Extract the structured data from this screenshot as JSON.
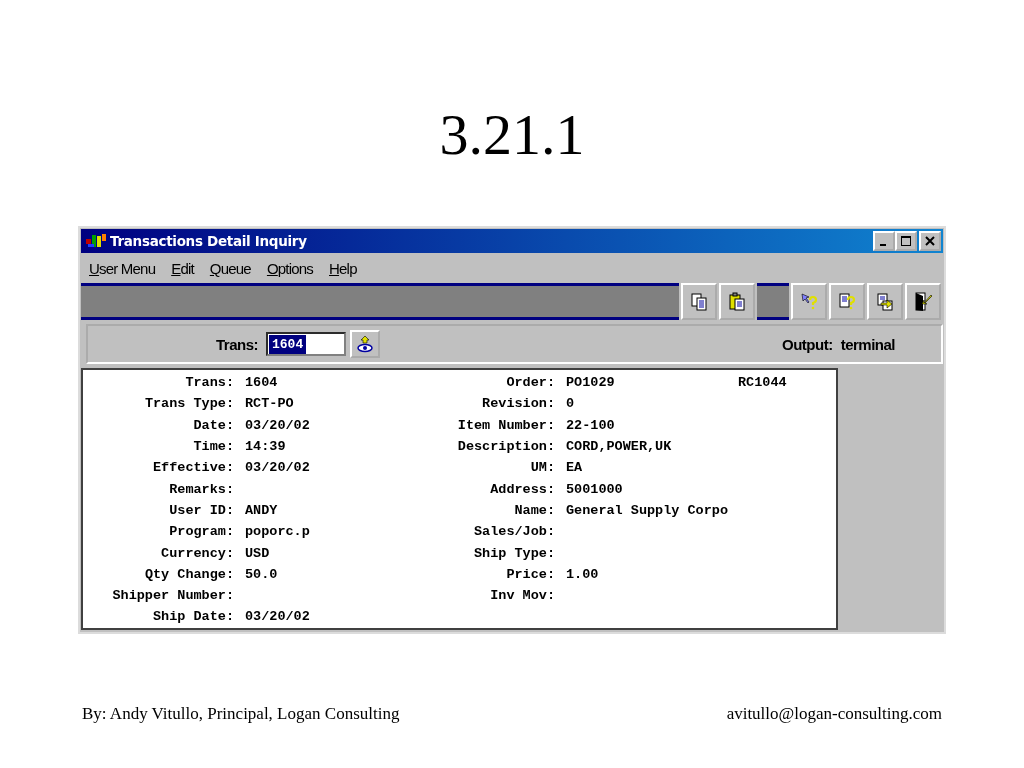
{
  "slide": {
    "title": "3.21.1",
    "footer_left": "By: Andy Vitullo, Principal, Logan Consulting",
    "footer_right": "avitullo@logan-consulting.com"
  },
  "window": {
    "title": "Transactions Detail Inquiry"
  },
  "menu": [
    "User Menu",
    "Edit",
    "Queue",
    "Options",
    "Help"
  ],
  "toolbar": {
    "groups": [
      [
        {
          "kind": "copy"
        },
        {
          "kind": "paste"
        }
      ],
      [
        {
          "kind": "pointer-help"
        },
        {
          "kind": "doc-help"
        },
        {
          "kind": "doc-export"
        },
        {
          "kind": "exit"
        }
      ]
    ]
  },
  "lookup": {
    "label": "Trans:",
    "value": "1604",
    "value_selected": true,
    "output_label": "Output:",
    "output_value": "terminal"
  },
  "detail": {
    "left": [
      {
        "label": "Trans:",
        "value": "1604"
      },
      {
        "label": "Trans Type:",
        "value": "RCT-PO"
      },
      {
        "label": "Date:",
        "value": "03/20/02"
      },
      {
        "label": "Time:",
        "value": "14:39"
      },
      {
        "label": "Effective:",
        "value": "03/20/02"
      },
      {
        "label": "Remarks:"
      },
      {
        "label": "User ID:",
        "value": "ANDY"
      },
      {
        "label": "Program:",
        "value": "poporc.p"
      },
      {
        "label": "Currency:",
        "value": "USD"
      },
      {
        "label": "Qty Change:",
        "value": "50.0"
      },
      {
        "label": "Shipper Number:"
      },
      {
        "label": "Ship Date:",
        "value": "03/20/02"
      }
    ],
    "right": [
      {
        "label": "Order:",
        "value": "PO1029",
        "extra": "RC1044"
      },
      {
        "label": "Revision:",
        "value": "0"
      },
      {
        "label": "Item Number:",
        "value": "22-100"
      },
      {
        "label": "Description:",
        "value": "CORD,POWER,UK"
      },
      {
        "label": "UM:",
        "value": "EA"
      },
      {
        "label": "Address:",
        "value": "5001000"
      },
      {
        "label": "Name:",
        "value": "General Supply Corpo"
      },
      {
        "label": "Sales/Job:"
      },
      {
        "label": "Ship Type:"
      },
      {
        "label": "Price:",
        "value": "1.00"
      },
      {
        "label": "Inv Mov:"
      }
    ]
  }
}
